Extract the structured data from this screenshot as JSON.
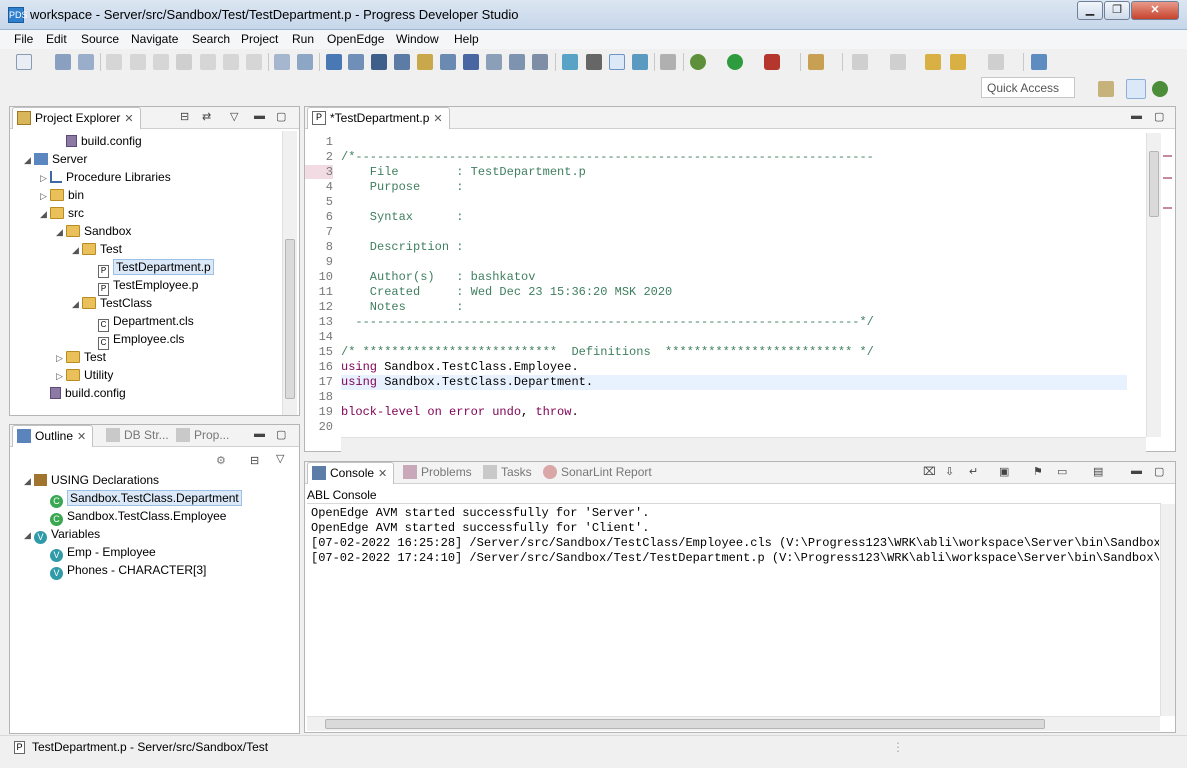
{
  "window": {
    "title": "workspace - Server/src/Sandbox/Test/TestDepartment.p - Progress Developer Studio",
    "app_icon_text": "PDS"
  },
  "menu": [
    "File",
    "Edit",
    "Source",
    "Navigate",
    "Search",
    "Project",
    "Run",
    "OpenEdge",
    "Window",
    "Help"
  ],
  "quick_access": {
    "placeholder": "Quick Access"
  },
  "project_explorer": {
    "tab_label": "Project Explorer",
    "items": [
      {
        "label": "build.config",
        "indent": 3,
        "type": "config",
        "arrow": ""
      },
      {
        "label": "Server",
        "indent": 1,
        "type": "project",
        "arrow": "◢"
      },
      {
        "label": "Procedure Libraries",
        "indent": 2,
        "type": "lib",
        "arrow": "▷"
      },
      {
        "label": "bin",
        "indent": 2,
        "type": "folder",
        "arrow": "▷"
      },
      {
        "label": "src",
        "indent": 2,
        "type": "folder",
        "arrow": "◢"
      },
      {
        "label": "Sandbox",
        "indent": 3,
        "type": "folder",
        "arrow": "◢"
      },
      {
        "label": "Test",
        "indent": 4,
        "type": "folder",
        "arrow": "◢"
      },
      {
        "label": "TestDepartment.p",
        "indent": 5,
        "type": "p",
        "arrow": "",
        "selected": true
      },
      {
        "label": "TestEmployee.p",
        "indent": 5,
        "type": "p",
        "arrow": ""
      },
      {
        "label": "TestClass",
        "indent": 4,
        "type": "folder",
        "arrow": "◢"
      },
      {
        "label": "Department.cls",
        "indent": 5,
        "type": "cls",
        "arrow": ""
      },
      {
        "label": "Employee.cls",
        "indent": 5,
        "type": "cls",
        "arrow": ""
      },
      {
        "label": "Test",
        "indent": 3,
        "type": "folder",
        "arrow": "▷"
      },
      {
        "label": "Utility",
        "indent": 3,
        "type": "folder",
        "arrow": "▷"
      },
      {
        "label": "build.config",
        "indent": 2,
        "type": "config",
        "arrow": ""
      }
    ]
  },
  "outline": {
    "tabs": [
      "Outline",
      "DB Str...",
      "Prop..."
    ],
    "items": [
      {
        "label": "USING Declarations",
        "indent": 1,
        "type": "using",
        "arrow": "◢"
      },
      {
        "label": "Sandbox.TestClass.Department",
        "indent": 2,
        "type": "c",
        "arrow": "",
        "selected": true
      },
      {
        "label": "Sandbox.TestClass.Employee",
        "indent": 2,
        "type": "c",
        "arrow": ""
      },
      {
        "label": "Variables",
        "indent": 1,
        "type": "v",
        "arrow": "◢"
      },
      {
        "label": "Emp - Employee",
        "indent": 2,
        "type": "v",
        "arrow": ""
      },
      {
        "label": "Phones - CHARACTER[3]",
        "indent": 2,
        "type": "v",
        "arrow": ""
      }
    ]
  },
  "editor": {
    "tab_label": "*TestDepartment.p",
    "lines": [
      {
        "n": "1",
        "parts": []
      },
      {
        "n": "2",
        "parts": [
          {
            "c": "cm",
            "t": "/*------------------------------------------------------------------------"
          }
        ]
      },
      {
        "n": "3",
        "parts": [
          {
            "c": "cm",
            "t": "    File        : TestDepartment.p"
          }
        ]
      },
      {
        "n": "4",
        "parts": [
          {
            "c": "cm",
            "t": "    Purpose     :"
          }
        ]
      },
      {
        "n": "5",
        "parts": []
      },
      {
        "n": "6",
        "parts": [
          {
            "c": "cm",
            "t": "    Syntax      :"
          }
        ]
      },
      {
        "n": "7",
        "parts": []
      },
      {
        "n": "8",
        "parts": [
          {
            "c": "cm",
            "t": "    Description :"
          }
        ]
      },
      {
        "n": "9",
        "parts": []
      },
      {
        "n": "10",
        "parts": [
          {
            "c": "cm",
            "t": "    Author(s)   : bashkatov"
          }
        ]
      },
      {
        "n": "11",
        "parts": [
          {
            "c": "cm",
            "t": "    Created     : Wed Dec 23 15:36:20 MSK 2020"
          }
        ]
      },
      {
        "n": "12",
        "parts": [
          {
            "c": "cm",
            "t": "    Notes       :"
          }
        ]
      },
      {
        "n": "13",
        "parts": [
          {
            "c": "cm",
            "t": "  ----------------------------------------------------------------------*/"
          }
        ]
      },
      {
        "n": "14",
        "parts": []
      },
      {
        "n": "15",
        "parts": [
          {
            "c": "cm",
            "t": "/* ***************************  Definitions  ************************** */"
          }
        ]
      },
      {
        "n": "16",
        "parts": [
          {
            "c": "kw",
            "t": "using"
          },
          {
            "c": "pl",
            "t": " Sandbox.TestClass.Employee."
          }
        ]
      },
      {
        "n": "17",
        "parts": [
          {
            "c": "kw",
            "t": "using"
          },
          {
            "c": "pl",
            "t": " Sandbox.TestClass.Department."
          }
        ]
      },
      {
        "n": "18",
        "parts": []
      },
      {
        "n": "19",
        "parts": [
          {
            "c": "kw",
            "t": "block-level on error undo"
          },
          {
            "c": "pl",
            "t": ", "
          },
          {
            "c": "kw",
            "t": "throw"
          },
          {
            "c": "pl",
            "t": "."
          }
        ]
      },
      {
        "n": "20",
        "parts": []
      }
    ]
  },
  "console": {
    "tabs": [
      "Console",
      "Problems",
      "Tasks",
      "SonarLint Report"
    ],
    "header": "ABL Console",
    "lines": [
      "OpenEdge AVM started successfully for 'Server'.",
      "OpenEdge AVM started successfully for 'Client'.",
      "[07-02-2022 16:25:28] /Server/src/Sandbox/TestClass/Employee.cls (V:\\Progress123\\WRK\\abli\\workspace\\Server\\bin\\Sandbox\\Tes",
      "[07-02-2022 17:24:10] /Server/src/Sandbox/Test/TestDepartment.p (V:\\Progress123\\WRK\\abli\\workspace\\Server\\bin\\Sandbox\\Test"
    ]
  },
  "status": {
    "text": "TestDepartment.p - Server/src/Sandbox/Test"
  },
  "colors": {
    "comment": "#3f7f5f",
    "keyword": "#7f0055",
    "selection": "#dbe8f7"
  }
}
